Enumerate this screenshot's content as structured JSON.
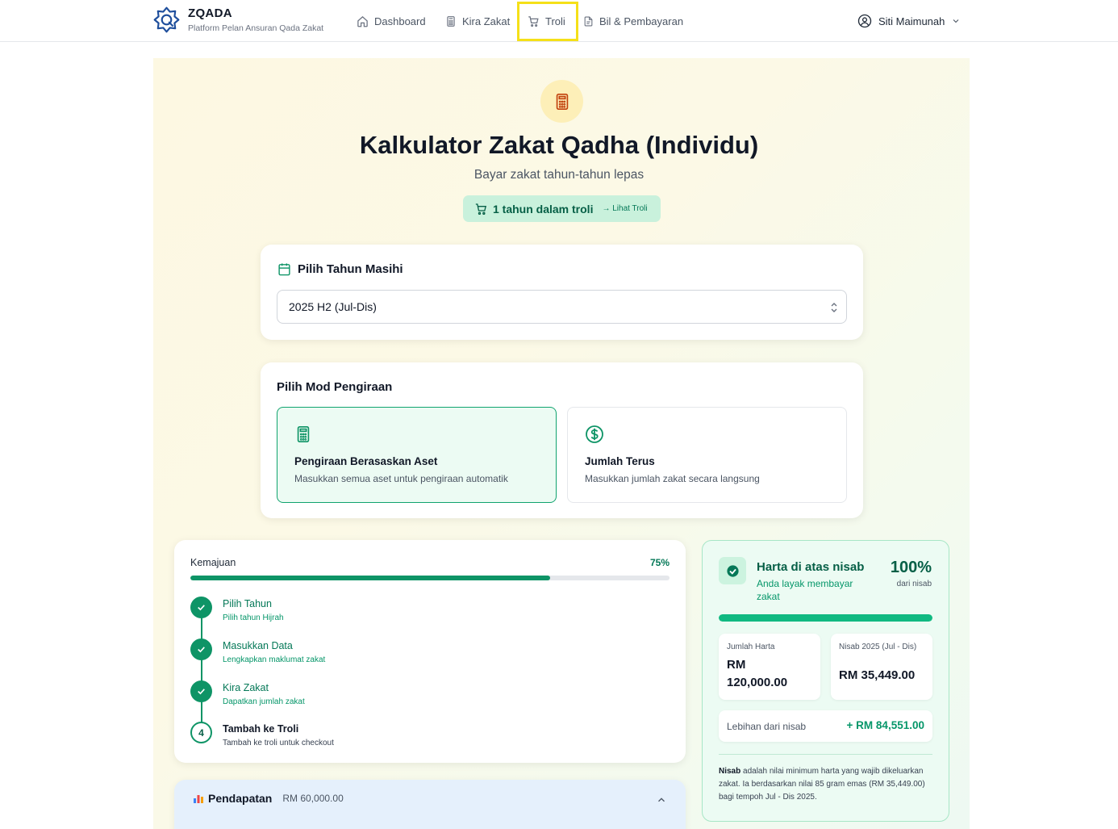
{
  "brand": {
    "name": "ZQADA",
    "tagline": "Platform Pelan Ansuran Qada Zakat"
  },
  "nav": {
    "dashboard": "Dashboard",
    "kira_zakat": "Kira Zakat",
    "troli": "Troli",
    "bil": "Bil & Pembayaran"
  },
  "user": {
    "name": "Siti Maimunah"
  },
  "hero": {
    "title": "Kalkulator Zakat Qadha (Individu)",
    "subtitle": "Bayar zakat tahun-tahun lepas",
    "cart_text": "1 tahun dalam troli",
    "cart_link": "→ Lihat Troli"
  },
  "year_card": {
    "heading": "Pilih Tahun Masihi",
    "selected": "2025 H2 (Jul-Dis)"
  },
  "mode_card": {
    "heading": "Pilih Mod Pengiraan",
    "options": [
      {
        "title": "Pengiraan Berasaskan Aset",
        "desc": "Masukkan semua aset untuk pengiraan automatik"
      },
      {
        "title": "Jumlah Terus",
        "desc": "Masukkan jumlah zakat secara langsung"
      }
    ]
  },
  "progress": {
    "label": "Kemajuan",
    "percent_text": "75%",
    "percent": 75,
    "steps": [
      {
        "title": "Pilih Tahun",
        "desc": "Pilih tahun Hijrah"
      },
      {
        "title": "Masukkan Data",
        "desc": "Lengkapkan maklumat zakat"
      },
      {
        "title": "Kira Zakat",
        "desc": "Dapatkan jumlah zakat"
      },
      {
        "number": "4",
        "title": "Tambah ke Troli",
        "desc": "Tambah ke troli untuk checkout"
      }
    ]
  },
  "income": {
    "title": "Pendapatan",
    "value": "RM 60,000.00"
  },
  "nisab": {
    "title": "Harta di atas nisab",
    "subtitle": "Anda layak membayar zakat",
    "percent_text": "100%",
    "percent_label": "dari nisab",
    "percent": 100,
    "total_label": "Jumlah Harta",
    "total_value_1": "RM",
    "total_value_2": "120,000.00",
    "nisab_label": "Nisab 2025 (Jul - Dis)",
    "nisab_value": "RM 35,449.00",
    "excess_label": "Lebihan dari nisab",
    "excess_value": "+ RM 84,551.00",
    "note_bold": "Nisab",
    "note_rest": " adalah nilai minimum harta yang wajib dikeluarkan zakat. Ia berdasarkan nilai 85 gram emas (RM 35,449.00) bagi tempoh Jul - Dis 2025."
  },
  "colors": {
    "primary": "#0e9466",
    "highlight": "#f5e018",
    "accent_yellow": "#fdefb8"
  }
}
